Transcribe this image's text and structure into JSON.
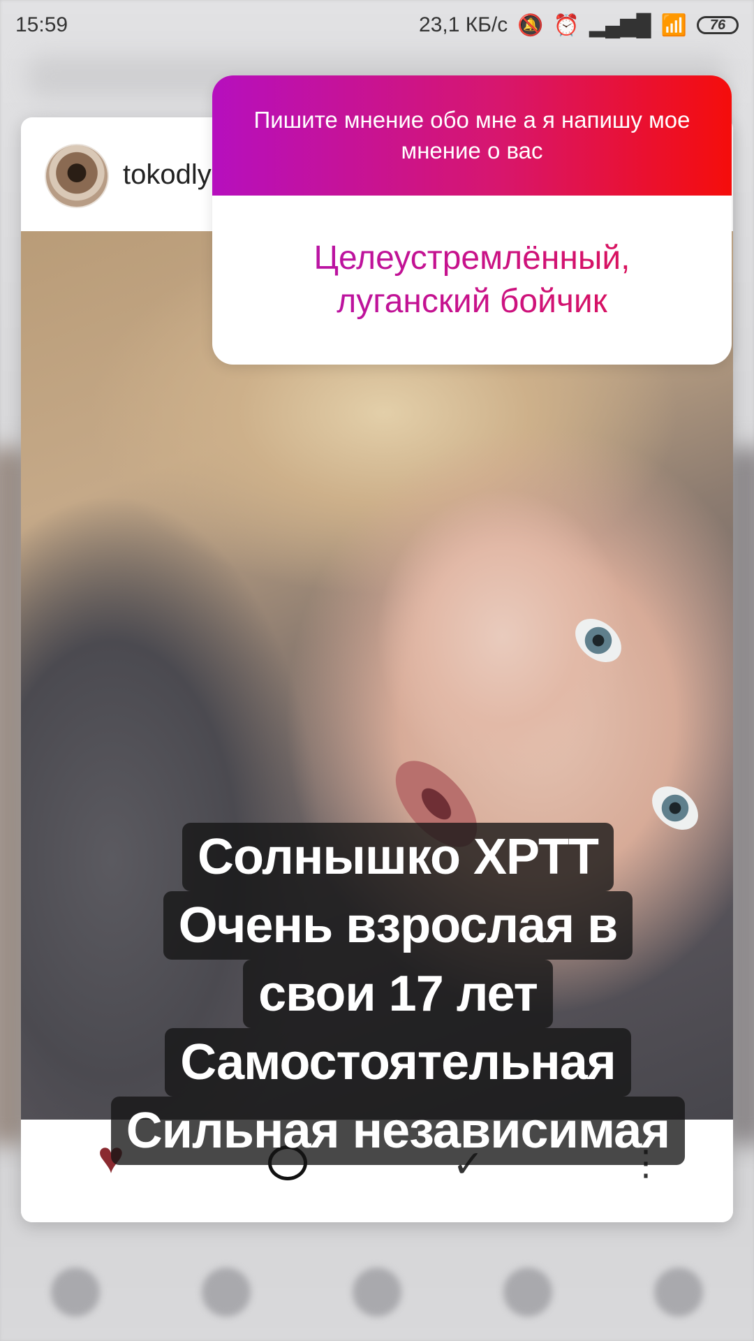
{
  "status_bar": {
    "time": "15:59",
    "network_speed": "23,1 КБ/с",
    "battery": "76"
  },
  "post": {
    "username": "tokodly",
    "actions": {
      "like_icon": "heart-icon",
      "comment_icon": "comment-icon",
      "share_icon": "share-icon",
      "more_icon": "more-icon"
    }
  },
  "question_sticker": {
    "prompt": "Пишите мнение обо мне а я напишу мое мнение о вас",
    "answer_line1": "Целеустремлённый,",
    "answer_line2": "луганский бойчик",
    "gradient": [
      "#b60fbe",
      "#f50d0b"
    ]
  },
  "overlay_text": {
    "lines": [
      "Солнышко ХРТТ",
      "Очень взрослая в",
      "свои 17 лет",
      "Самостоятельная",
      "Сильная независимая"
    ]
  }
}
